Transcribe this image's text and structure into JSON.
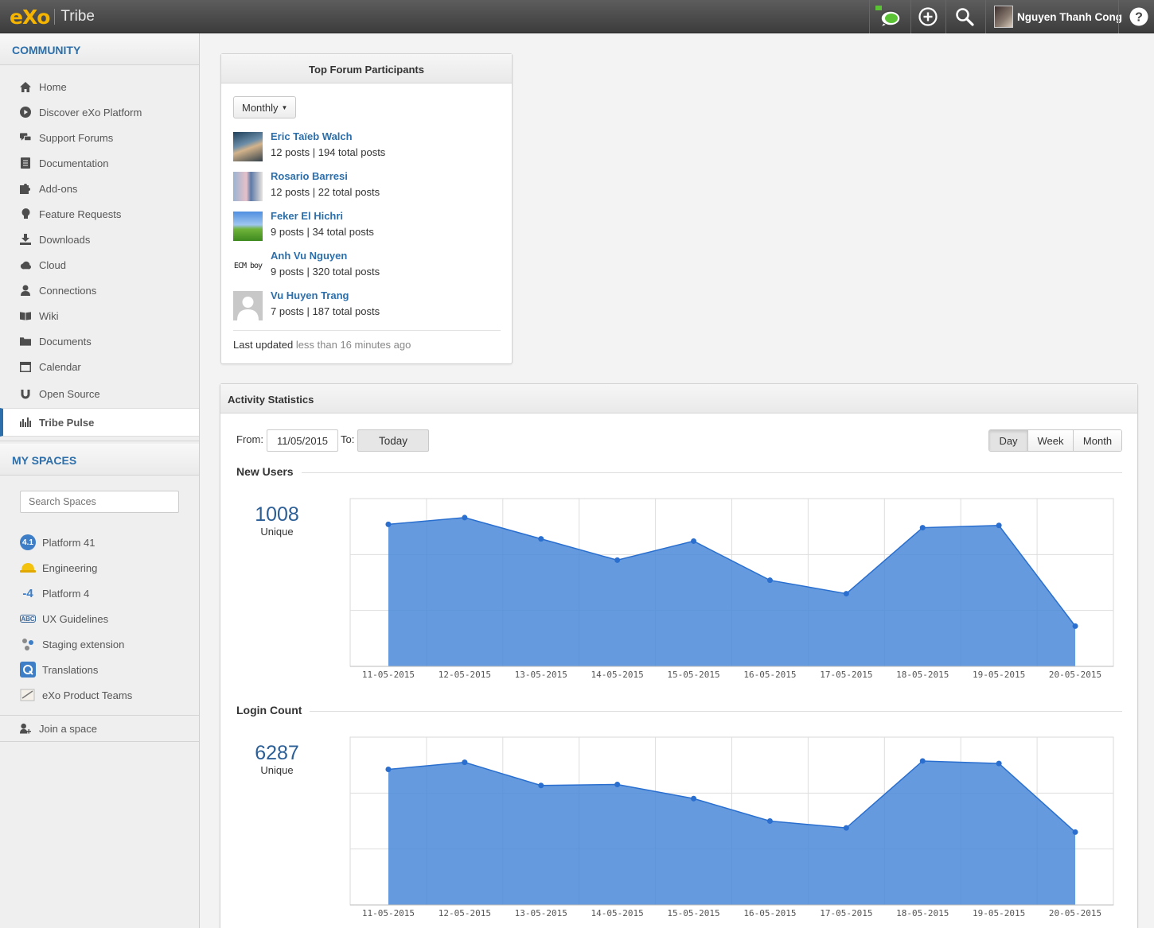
{
  "topbar": {
    "logo_exo": "eXo",
    "logo_app": "Tribe",
    "user_name": "Nguyen Thanh Cong",
    "help_label": "?"
  },
  "sidebar": {
    "community_title": "COMMUNITY",
    "items": [
      {
        "label": "Home",
        "icon": "home-icon"
      },
      {
        "label": "Discover eXo Platform",
        "icon": "play-circle-icon"
      },
      {
        "label": "Support Forums",
        "icon": "chat-bubbles-icon"
      },
      {
        "label": "Documentation",
        "icon": "document-icon"
      },
      {
        "label": "Add-ons",
        "icon": "puzzle-icon"
      },
      {
        "label": "Feature Requests",
        "icon": "lightbulb-icon"
      },
      {
        "label": "Downloads",
        "icon": "download-icon"
      },
      {
        "label": "Cloud",
        "icon": "cloud-icon"
      },
      {
        "label": "Connections",
        "icon": "user-icon"
      },
      {
        "label": "Wiki",
        "icon": "book-icon"
      },
      {
        "label": "Documents",
        "icon": "folder-icon"
      },
      {
        "label": "Calendar",
        "icon": "calendar-icon"
      },
      {
        "label": "Open Source",
        "icon": "horseshoe-icon"
      },
      {
        "label": "Tribe Pulse",
        "icon": "bar-chart-icon"
      }
    ],
    "spaces_title": "MY SPACES",
    "search_placeholder": "Search Spaces",
    "spaces": [
      {
        "label": "Platform 41",
        "badge": "4.1",
        "color": "#3d7ec6"
      },
      {
        "label": "Engineering",
        "badge": "",
        "color": "#f2c20f"
      },
      {
        "label": "Platform 4",
        "badge": "-4",
        "color": "#ffffff"
      },
      {
        "label": "UX Guidelines",
        "badge": "ABC",
        "color": "#ffffff"
      },
      {
        "label": "Staging extension",
        "badge": "",
        "color": "#ffffff"
      },
      {
        "label": "Translations",
        "badge": "",
        "color": "#3d7ec6"
      },
      {
        "label": "eXo Product Teams",
        "badge": "",
        "color": "#ffffff"
      }
    ],
    "join_label": "Join a space"
  },
  "forum": {
    "title": "Top Forum Participants",
    "period": "Monthly",
    "participants": [
      {
        "name": "Eric Taïeb Walch",
        "posts": "12 posts | 194 total posts"
      },
      {
        "name": "Rosario Barresi",
        "posts": "12 posts | 22 total posts"
      },
      {
        "name": "Feker El Hichri",
        "posts": "9 posts | 34 total posts"
      },
      {
        "name": "Anh Vu Nguyen",
        "posts": "9 posts | 320 total posts"
      },
      {
        "name": "Vu Huyen Trang",
        "posts": "7 posts | 187 total posts"
      }
    ],
    "avatar_text_ecm": "ECM boy",
    "last_updated_label": "Last updated",
    "last_updated_value": "less than 16 minutes ago"
  },
  "stats": {
    "title": "Activity Statistics",
    "from_label": "From:",
    "from_value": "11/05/2015",
    "to_label": "To:",
    "to_value": "Today",
    "ranges": [
      "Day",
      "Week",
      "Month"
    ],
    "active_range": "Day",
    "new_users": {
      "title": "New Users",
      "total": "1008",
      "sub": "Unique"
    },
    "login_count": {
      "title": "Login Count",
      "total": "6287",
      "sub": "Unique"
    }
  },
  "chart_data": [
    {
      "type": "area",
      "title": "",
      "color": "#4a8ad8",
      "categories": [
        "11-05-2015",
        "12-05-2015",
        "13-05-2015",
        "14-05-2015",
        "15-05-2015",
        "16-05-2015",
        "17-05-2015",
        "18-05-2015",
        "19-05-2015",
        "20-05-2015"
      ],
      "values": [
        127,
        133,
        114,
        95,
        112,
        77,
        65,
        124,
        126,
        36
      ],
      "ylim": [
        0,
        150
      ],
      "grid": true
    },
    {
      "type": "area",
      "title": "",
      "color": "#4a8ad8",
      "categories": [
        "11-05-2015",
        "12-05-2015",
        "13-05-2015",
        "14-05-2015",
        "15-05-2015",
        "16-05-2015",
        "17-05-2015",
        "18-05-2015",
        "19-05-2015",
        "20-05-2015"
      ],
      "values": [
        808,
        850,
        712,
        718,
        634,
        500,
        459,
        858,
        843,
        434
      ],
      "ylim": [
        0,
        1000
      ],
      "grid": true
    }
  ]
}
